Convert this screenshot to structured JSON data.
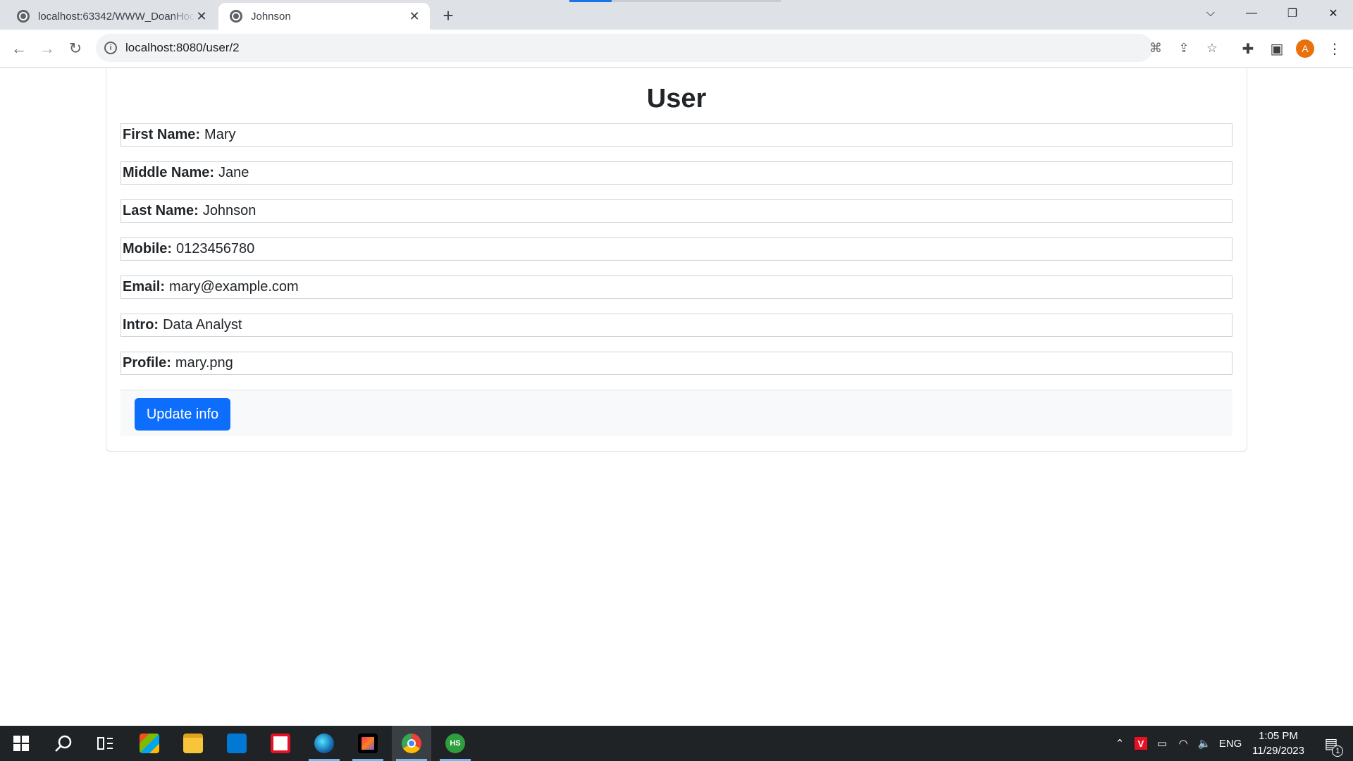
{
  "browser": {
    "tabs": [
      {
        "title": "localhost:63342/WWW_DoanHoc",
        "active": false
      },
      {
        "title": "Johnson",
        "active": true
      }
    ],
    "new_tab_symbol": "+",
    "url": "localhost:8080/user/2",
    "profile_initial": "A",
    "icons": [
      "back-arrow-icon",
      "forward-arrow-icon",
      "reload-icon",
      "site-info-icon",
      "translate-icon",
      "share-icon",
      "bookmark-star-icon",
      "extensions-puzzle-icon",
      "side-panel-icon",
      "menu-kebab-icon"
    ],
    "accent_color": "#1a73e8"
  },
  "page": {
    "title": "User",
    "fields": [
      {
        "label": "First Name:",
        "value": "Mary"
      },
      {
        "label": "Middle Name:",
        "value": "Jane"
      },
      {
        "label": "Last Name:",
        "value": "Johnson"
      },
      {
        "label": "Mobile:",
        "value": "0123456780"
      },
      {
        "label": "Email:",
        "value": "mary@example.com"
      },
      {
        "label": "Intro:",
        "value": "Data Analyst"
      },
      {
        "label": "Profile:",
        "value": "mary.png"
      }
    ],
    "update_button": "Update info",
    "button_color": "#0d6efd"
  },
  "taskbar": {
    "apps": [
      "start-icon",
      "search-icon",
      "task-view-icon",
      "store-icon",
      "file-explorer-icon",
      "mail-icon",
      "news-icon",
      "edge-icon",
      "intellij-icon",
      "chrome-icon",
      "hs-app-icon"
    ],
    "language": "ENG",
    "time": "1:05 PM",
    "date": "11/29/2023",
    "notification_count": "1"
  }
}
